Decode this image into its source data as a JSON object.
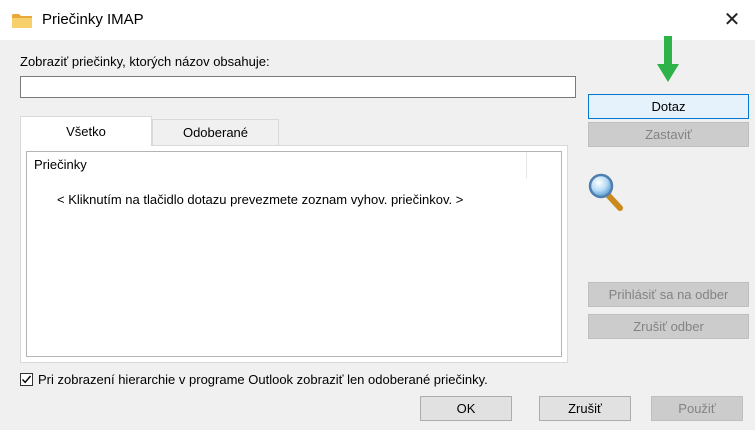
{
  "window": {
    "title": "Priečinky IMAP",
    "close_glyph": "✕"
  },
  "filter": {
    "label": "Zobraziť priečinky, ktorých názov obsahuje:",
    "value": "",
    "placeholder": ""
  },
  "buttons": {
    "query": "Dotaz",
    "stop": "Zastaviť",
    "subscribe": "Prihlásiť sa na odber",
    "unsubscribe": "Zrušiť odber",
    "ok": "OK",
    "cancel": "Zrušiť",
    "apply": "Použiť"
  },
  "tabs": [
    {
      "label": "Všetko",
      "active": true
    },
    {
      "label": "Odoberané",
      "active": false
    }
  ],
  "list": {
    "column_header": "Priečinky",
    "empty_message": "< Kliknutím na tlačidlo dotazu prevezmete zoznam vyhov. priečinkov. >"
  },
  "checkbox": {
    "label": "Pri zobrazení hierarchie v programe Outlook zobraziť len odoberané priečinky.",
    "checked": true
  },
  "icons": {
    "title": "folder-icon",
    "search": "magnifier-icon",
    "arrow": "green-arrow-down-icon"
  },
  "colors": {
    "accent": "#0078d7",
    "arrow": "#2db34a",
    "folder": "#f2c14e"
  }
}
